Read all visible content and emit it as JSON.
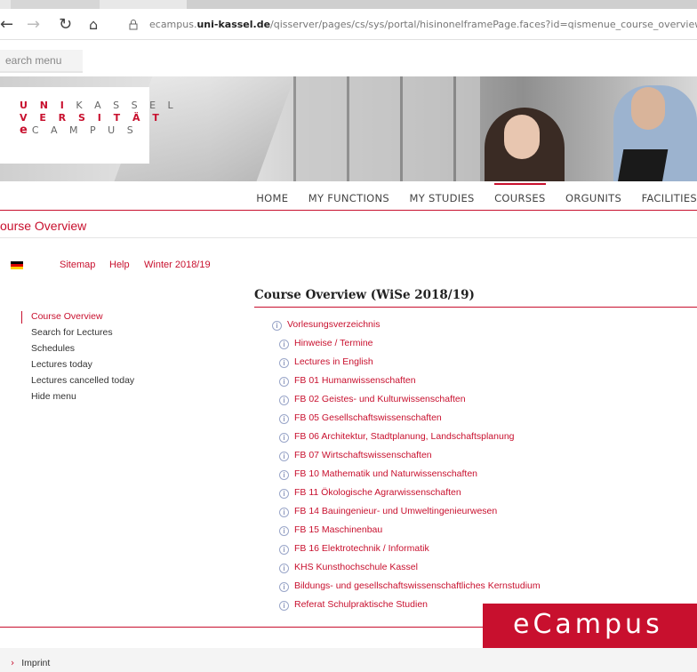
{
  "browser": {
    "url_prefix": "ecampus.",
    "url_host": "uni-kassel.de",
    "url_path": "/qisserver/pages/cs/sys/portal/hisinoneIframePage.faces?id=qismenue_course_overview&navigationPosition=link_qismenue_"
  },
  "search_menu": {
    "label": "earch menu"
  },
  "logo": {
    "line1_red": "U N I",
    "line1_grey": "K A S S E L",
    "line2": "V E R S I T Ä T",
    "line3_e": "e",
    "line3_rest": "C A M P U S"
  },
  "main_nav": {
    "items": [
      "HOME",
      "MY FUNCTIONS",
      "MY STUDIES",
      "COURSES",
      "ORGUNITS",
      "FACILITIES"
    ],
    "active": "COURSES"
  },
  "page_heading": "ourse Overview",
  "utility": {
    "sitemap": "Sitemap",
    "help": "Help",
    "semester": "Winter 2018/19"
  },
  "left_menu": {
    "items": [
      "Course Overview",
      "Search for Lectures",
      "Schedules",
      "Lectures today",
      "Lectures cancelled today",
      "Hide menu"
    ]
  },
  "content": {
    "title": "Course Overview (WiSe 2018/19)",
    "root": "Vorlesungsverzeichnis",
    "children": [
      "Hinweise / Termine",
      "Lectures in English",
      "FB 01 Humanwissenschaften",
      "FB 02 Geistes- und Kulturwissenschaften",
      "FB 05 Gesellschaftswissenschaften",
      "FB 06 Architektur, Stadtplanung, Landschaftsplanung",
      "FB 07 Wirtschaftswissenschaften",
      "FB 10 Mathematik und Naturwissenschaften",
      "FB 11 Ökologische Agrarwissenschaften",
      "FB 14 Bauingenieur- und Umweltingenieurwesen",
      "FB 15 Maschinenbau",
      "FB 16 Elektrotechnik / Informatik",
      "KHS Kunsthochschule Kassel",
      "Bildungs- und gesellschaftswissenschaftliches Kernstudium",
      "Referat Schulpraktische Studien"
    ]
  },
  "badge": "eCampus",
  "footer": {
    "imprint": "Imprint"
  }
}
